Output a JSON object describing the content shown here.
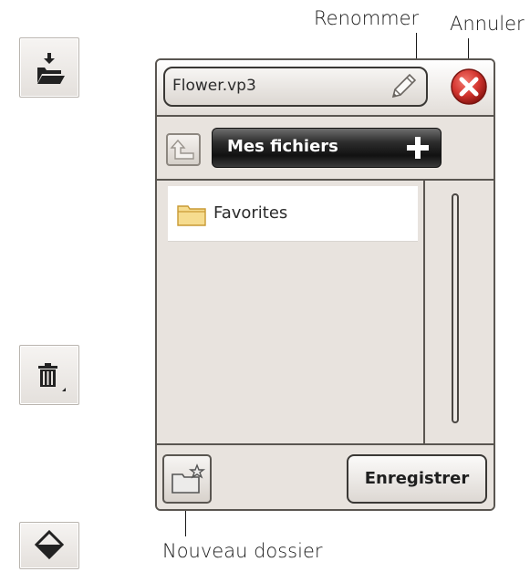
{
  "callouts": {
    "rename": "Renommer",
    "cancel": "Annuler",
    "new_folder": "Nouveau dossier"
  },
  "side_buttons": [
    {
      "icon": "folder-open-download-icon"
    },
    {
      "icon": "trash-icon"
    },
    {
      "icon": "diamond-icon"
    }
  ],
  "dialog": {
    "filename": "Flower.vp3",
    "current_folder": "Mes fichiers",
    "items": [
      {
        "label": "Favorites",
        "icon": "folder-icon"
      }
    ],
    "save_label": "Enregistrer"
  },
  "colors": {
    "dialog_bg": "#e8e3de",
    "border": "#5a5651",
    "cancel_red": "#d3352f",
    "folder_yellow": "#f2d27a"
  }
}
